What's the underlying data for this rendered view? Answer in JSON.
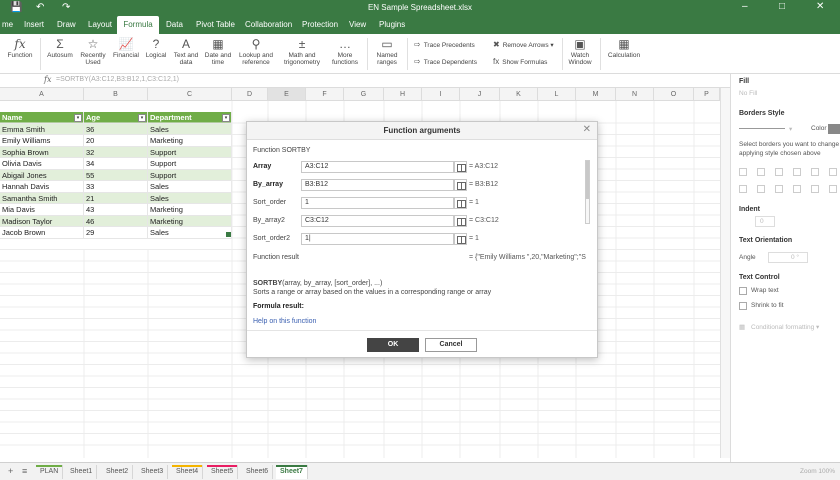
{
  "app": {
    "title": "EN Sample Spreadsheet.xlsx",
    "tabs": [
      "me",
      "Insert",
      "Draw",
      "Layout",
      "Formula",
      "Data",
      "Pivot Table",
      "Collaboration",
      "Protection",
      "View",
      "Plugins"
    ],
    "active_tab": "Formula"
  },
  "ribbon": {
    "function_label": "Function",
    "autosum": [
      "Autosum",
      ""
    ],
    "recently_used": [
      "Recently",
      "Used"
    ],
    "financial": [
      "Financial",
      ""
    ],
    "logical": [
      "Logical",
      ""
    ],
    "text_data": [
      "Text and",
      "data"
    ],
    "date_time": [
      "Date and",
      "time"
    ],
    "lookup": [
      "Lookup and",
      "reference"
    ],
    "math": [
      "Math and",
      "trigonometry"
    ],
    "more_functions": [
      "More",
      "functions"
    ],
    "named_ranges": [
      "Named",
      "ranges"
    ],
    "trace_precedents": "Trace Precedents",
    "trace_dependents": "Trace Dependents",
    "remove_arrows": "Remove Arrows",
    "show_formulas": "Show Formulas",
    "watch_window": [
      "Watch",
      "Window"
    ],
    "calculation": [
      "Calculation",
      ""
    ]
  },
  "formula_bar": {
    "fx": "fx",
    "formula": "=SORTBY(A3:C12,B3:B12,1,C3:C12,1)"
  },
  "grid": {
    "columns": [
      "A",
      "B",
      "C",
      "D",
      "E",
      "F",
      "G",
      "H",
      "I",
      "J",
      "K",
      "L",
      "M",
      "N",
      "O",
      "P"
    ],
    "header_row": [
      "Name",
      "Age",
      "Department"
    ],
    "rows": [
      [
        "Emma Smith",
        "36",
        "Sales"
      ],
      [
        "Emily Williams",
        "20",
        "Marketing"
      ],
      [
        "Sophia Brown",
        "32",
        "Support"
      ],
      [
        "Olivia Davis",
        "34",
        "Support"
      ],
      [
        "Abigail Jones",
        "55",
        "Support"
      ],
      [
        "Hannah Davis",
        "33",
        "Sales"
      ],
      [
        "Samantha Smith",
        "21",
        "Sales"
      ],
      [
        "Mia Davis",
        "43",
        "Marketing"
      ],
      [
        "Madison Taylor",
        "46",
        "Marketing"
      ],
      [
        "Jacob Brown",
        "29",
        "Sales"
      ]
    ]
  },
  "dialog": {
    "title": "Function arguments",
    "function_name": "Function  SORTBY",
    "args": [
      {
        "label": "Array",
        "value": "A3:C12",
        "result": "= A3:C12",
        "bold": true
      },
      {
        "label": "By_array",
        "value": "B3:B12",
        "result": "= B3:B12",
        "bold": true
      },
      {
        "label": "Sort_order",
        "value": "1",
        "result": "= 1",
        "bold": false
      },
      {
        "label": "By_array2",
        "value": "C3:C12",
        "result": "= C3:C12",
        "bold": false
      },
      {
        "label": "Sort_order2",
        "value": "1|",
        "result": "= 1",
        "bold": false
      }
    ],
    "function_result_label": "Function result",
    "function_result_value": "= {\"Emily Williams \",20,\"Marketing\";\"S",
    "syntax_name": "SORTBY",
    "syntax_args": "(array, by_array, [sort_order], ...)",
    "description": "Sorts a range or array based on the values in a corresponding range or array",
    "formula_result_label": "Formula result:",
    "help_link": "Help on this function",
    "ok_label": "OK",
    "cancel_label": "Cancel"
  },
  "right_panel": {
    "fill_label": "Fill",
    "fill_value": "No Fill",
    "borders_style": "Borders Style",
    "color_label": "Color",
    "borders_help": "Select borders you want to change applying style chosen above",
    "indent_label": "Indent",
    "indent_value": "0",
    "text_orientation": "Text Orientation",
    "angle_label": "Angle",
    "angle_value": "0 °",
    "text_control": "Text Control",
    "wrap_text": "Wrap text",
    "shrink_to_fit": "Shrink to fit",
    "conditional_formatting": "Conditional formatting"
  },
  "sheets": {
    "items": [
      {
        "name": "PLAN",
        "color": "#70ad47"
      },
      {
        "name": "Sheet1",
        "color": ""
      },
      {
        "name": "Sheet2",
        "color": ""
      },
      {
        "name": "Sheet3",
        "color": ""
      },
      {
        "name": "Sheet4",
        "color": "#f4b400"
      },
      {
        "name": "Sheet5",
        "color": "#e91e63"
      },
      {
        "name": "Sheet6",
        "color": ""
      },
      {
        "name": "Sheet7",
        "color": "#3a7a43"
      }
    ],
    "active": "Sheet7",
    "zoom_text": "Zoom 100%"
  }
}
